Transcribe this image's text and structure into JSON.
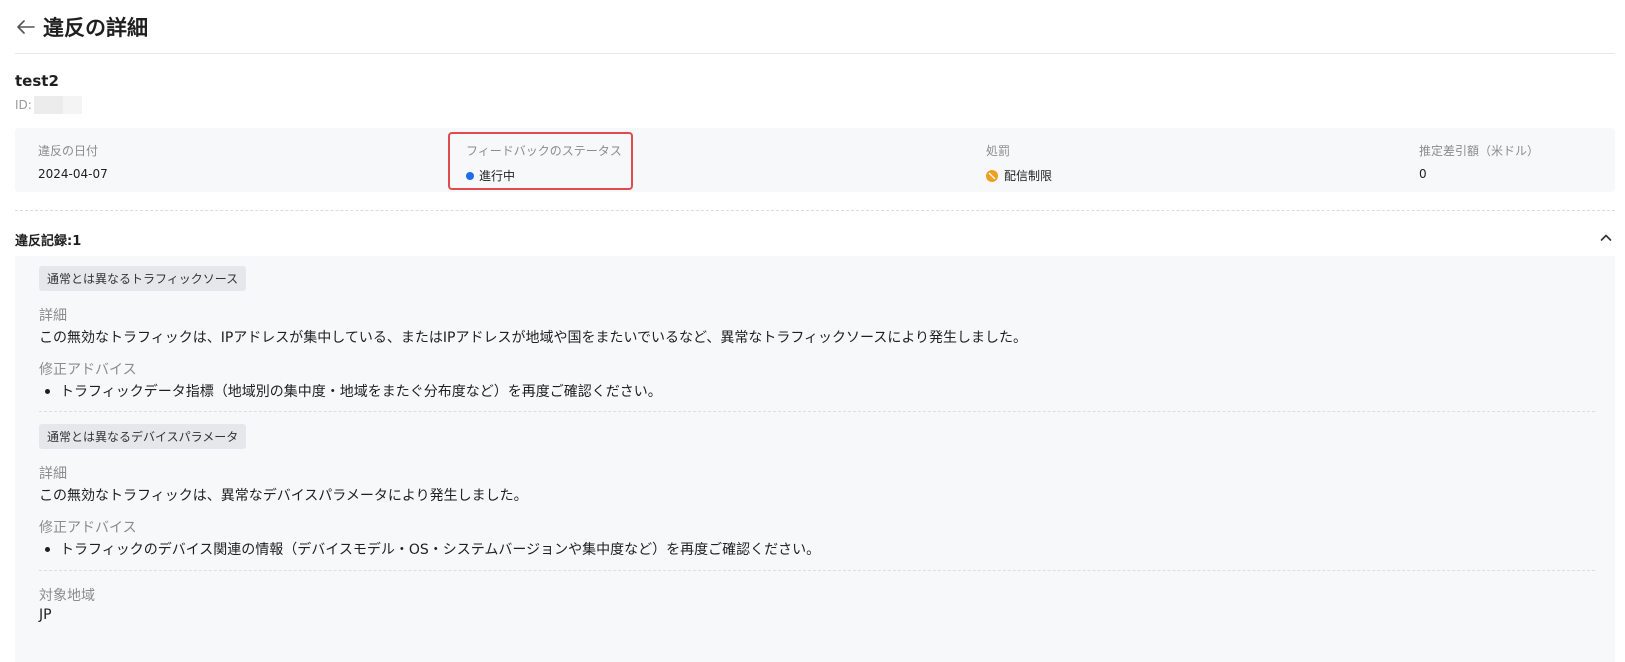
{
  "header": {
    "title": "違反の詳細"
  },
  "account": {
    "name": "test2",
    "id_label": "ID:"
  },
  "summary": {
    "date_label": "違反の日付",
    "date_value": "2024-04-07",
    "status_label": "フィードバックのステータス",
    "status_value": "進行中",
    "status_color": "#1e6cf0",
    "penalty_label": "処罰",
    "penalty_value": "配信制限",
    "penalty_color": "#f0a020",
    "deduction_label": "推定差引額（米ドル）",
    "deduction_value": "0"
  },
  "records": {
    "title": "違反記録:1",
    "items": [
      {
        "tag": "通常とは異なるトラフィックソース",
        "detail_label": "詳細",
        "detail_text": "この無効なトラフィックは、IPアドレスが集中している、またはIPアドレスが地域や国をまたいでいるなど、異常なトラフィックソースにより発生しました。",
        "advice_label": "修正アドバイス",
        "advice_items": [
          "トラフィックデータ指標（地域別の集中度・地域をまたぐ分布度など）を再度ご確認ください。"
        ]
      },
      {
        "tag": "通常とは異なるデバイスパラメータ",
        "detail_label": "詳細",
        "detail_text": "この無効なトラフィックは、異常なデバイスパラメータにより発生しました。",
        "advice_label": "修正アドバイス",
        "advice_items": [
          "トラフィックのデバイス関連の情報（デバイスモデル・OS・システムバージョンや集中度など）を再度ご確認ください。"
        ]
      }
    ],
    "region_label": "対象地域",
    "region_value": "JP"
  },
  "icons": {
    "back": "arrow-left-icon",
    "collapse": "chevron-up-icon",
    "penalty": "restriction-icon"
  }
}
